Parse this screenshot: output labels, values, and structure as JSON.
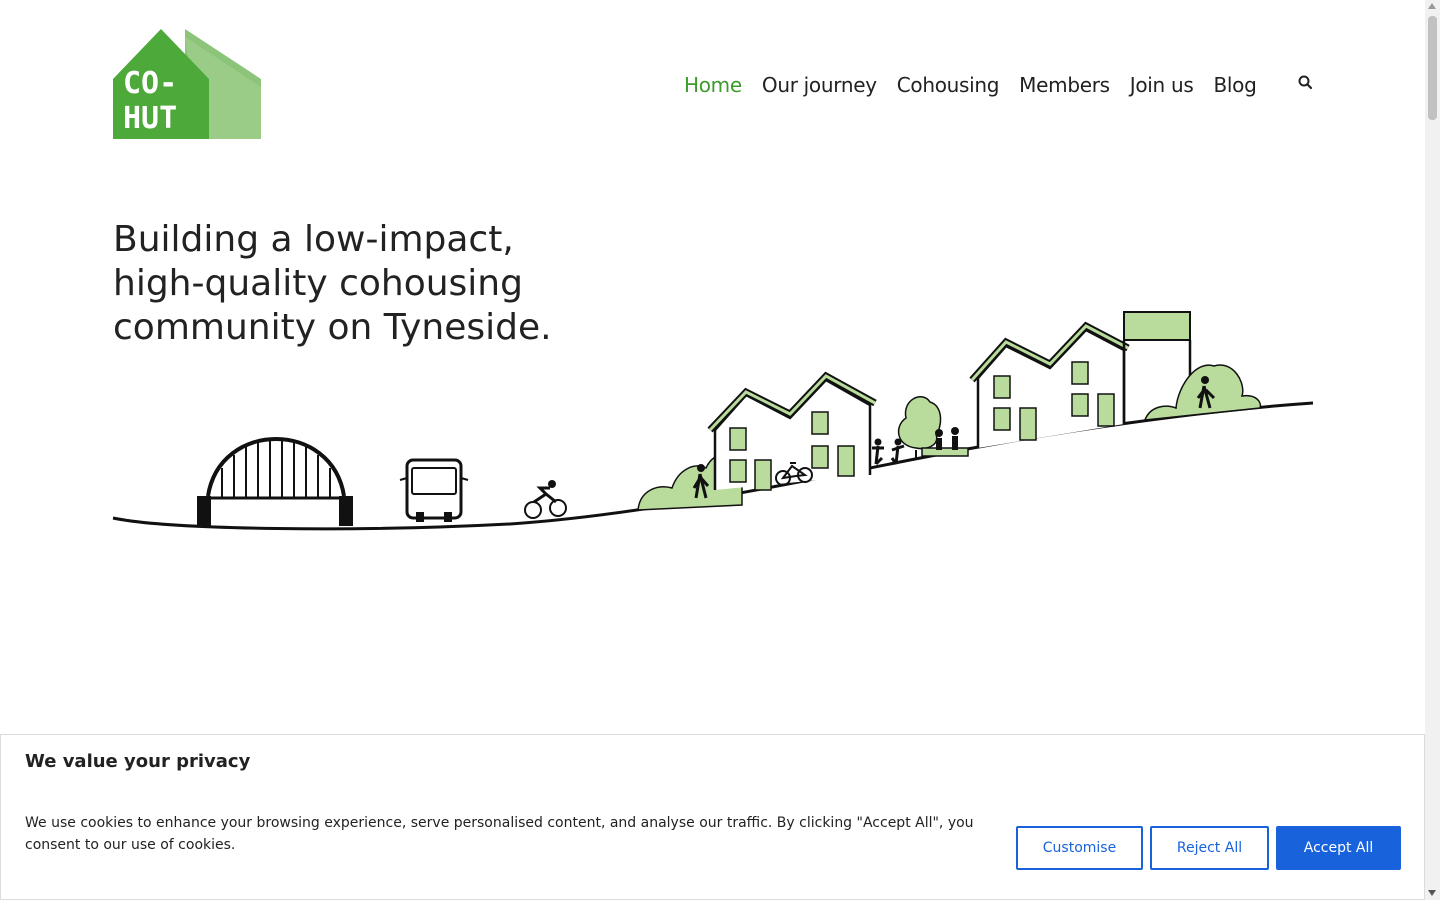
{
  "logo": {
    "line1": "CO-",
    "line2": "HUT",
    "icon": "house-logo"
  },
  "nav": {
    "items": [
      {
        "label": "Home",
        "active": true
      },
      {
        "label": "Our journey",
        "active": false
      },
      {
        "label": "Cohousing",
        "active": false
      },
      {
        "label": "Members",
        "active": false
      },
      {
        "label": "Join us",
        "active": false
      },
      {
        "label": "Blog",
        "active": false
      }
    ],
    "search_icon": "search-icon"
  },
  "hero": {
    "title": "Building a low-impact, high-quality cohousing community on Tyneside."
  },
  "cookie_banner": {
    "title": "We value your privacy",
    "text": "We use cookies to enhance your browsing experience, serve personalised content, and analyse our traffic. By clicking \"Accept All\", you consent to our use of cookies.",
    "customise_label": "Customise",
    "reject_label": "Reject All",
    "accept_label": "Accept All"
  },
  "colors": {
    "brand_green": "#3d9b2c",
    "illustration_green": "#b9dc9c",
    "button_blue": "#1863dc"
  }
}
